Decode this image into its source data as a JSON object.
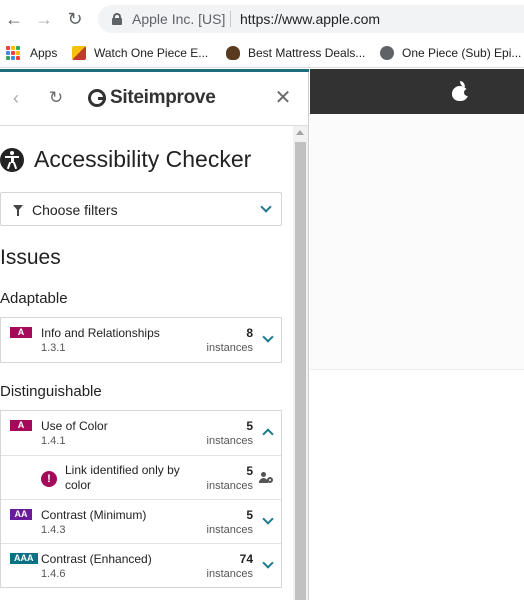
{
  "browser": {
    "site_identity": "Apple Inc. [US]",
    "url": "https://www.apple.com",
    "bookmarks": [
      {
        "label": "Apps",
        "icon": "apps-grid-icon"
      },
      {
        "label": "Watch One Piece E...",
        "icon": "bookmark-favicon"
      },
      {
        "label": "Best Mattress Deals...",
        "icon": "bookmark-favicon"
      },
      {
        "label": "One Piece (Sub) Epi...",
        "icon": "globe-icon"
      }
    ]
  },
  "panel": {
    "brand": "Siteimprove",
    "title": "Accessibility Checker",
    "filter_label": "Choose filters",
    "issues_heading": "Issues",
    "groups": [
      {
        "heading": "Adaptable",
        "issues": [
          {
            "level": "A",
            "name": "Info and Relationships",
            "code": "1.3.1",
            "count": "8",
            "unit": "instances",
            "expanded": false
          }
        ]
      },
      {
        "heading": "Distinguishable",
        "issues": [
          {
            "level": "A",
            "name": "Use of Color",
            "code": "1.4.1",
            "count": "5",
            "unit": "instances",
            "expanded": true,
            "sub": {
              "name": "Link identified only by color",
              "count": "5",
              "unit": "instances"
            }
          },
          {
            "level": "AA",
            "name": "Contrast (Minimum)",
            "code": "1.4.3",
            "count": "5",
            "unit": "instances",
            "expanded": false
          },
          {
            "level": "AAA",
            "name": "Contrast (Enhanced)",
            "code": "1.4.6",
            "count": "74",
            "unit": "instances",
            "expanded": false
          }
        ]
      }
    ]
  },
  "colors": {
    "accent_teal": "#1c6d7e",
    "level_a": "#a50a5a",
    "level_aa": "#6a1b9a",
    "level_aaa": "#0b7285",
    "apple_nav": "#323232"
  }
}
